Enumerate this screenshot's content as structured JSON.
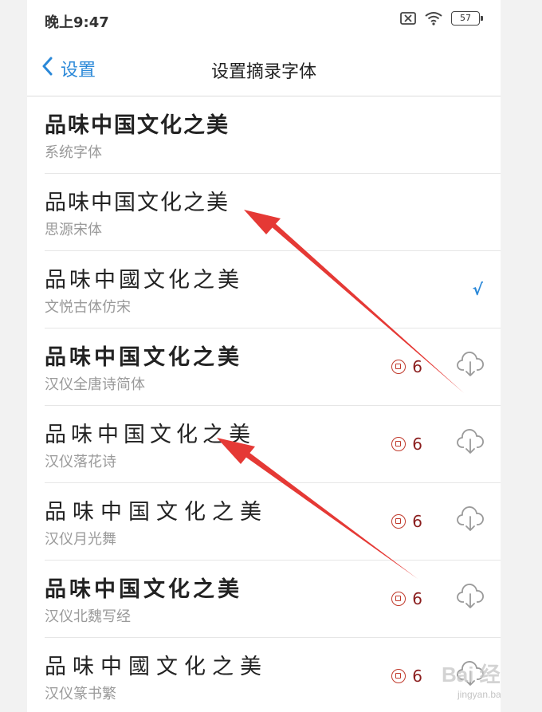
{
  "status_bar": {
    "time": "晚上9:47",
    "battery": "57",
    "icons": [
      "sim-disabled-icon",
      "wifi-icon",
      "battery-icon"
    ]
  },
  "nav": {
    "back_label": "设置",
    "title": "设置摘录字体"
  },
  "fonts": [
    {
      "sample": "品味中国文化之美",
      "name": "系统字体"
    },
    {
      "sample": "品味中国文化之美",
      "name": "思源宋体"
    },
    {
      "sample": "品味中國文化之美",
      "name": "文悦古体仿宋",
      "check": "√"
    },
    {
      "sample": "品味中国文化之美",
      "name": "汉仪全唐诗简体",
      "price": "6"
    },
    {
      "sample": "品味中国文化之美",
      "name": "汉仪落花诗",
      "price": "6"
    },
    {
      "sample": "品味中国文化之美",
      "name": "汉仪月光舞",
      "price": "6"
    },
    {
      "sample": "品味中国文化之美",
      "name": "汉仪北魏写经",
      "price": "6"
    },
    {
      "sample": "品味中國文化之美",
      "name": "汉仪篆书繁",
      "price": "6"
    }
  ],
  "colors": {
    "accent": "#2a88d8",
    "price": "#8b1e1e",
    "arrow": "#e53935"
  },
  "watermark": {
    "text": "Bai 经验",
    "sub": "jingyan.baidu.com"
  }
}
